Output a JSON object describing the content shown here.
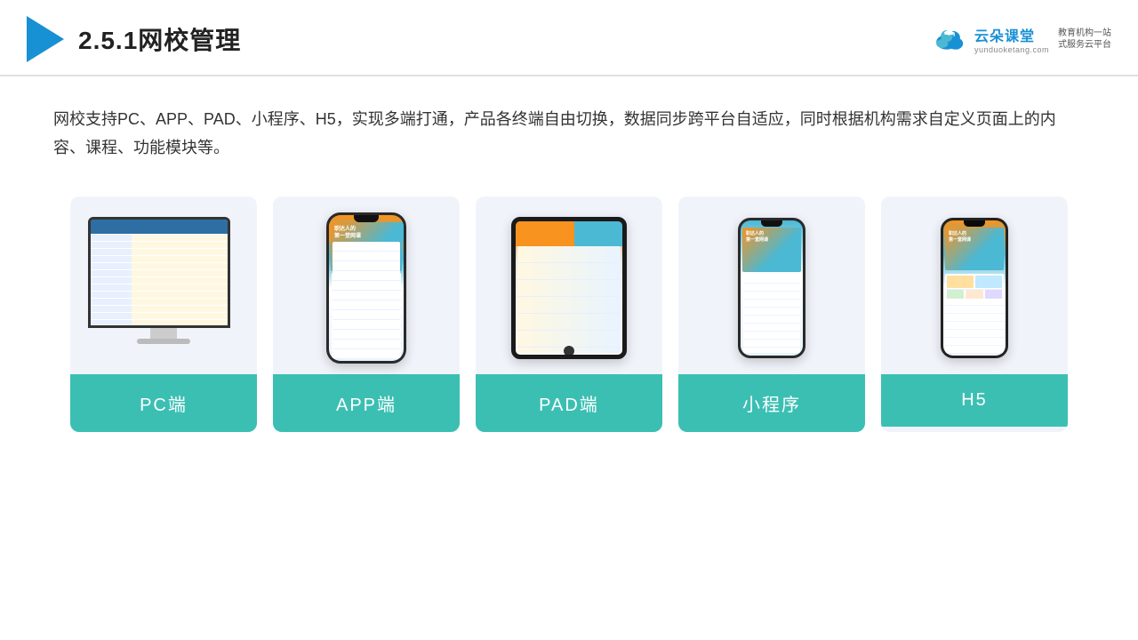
{
  "header": {
    "title": "2.5.1网校管理",
    "brand": {
      "name": "云朵课堂",
      "url": "yunduoketang.com",
      "slogan": "教育机构一站\n式服务云平台"
    }
  },
  "description": "网校支持PC、APP、PAD、小程序、H5，实现多端打通，产品各终端自由切换，数据同步跨平台自适应，同时根据机构需求自定义页面上的内容、课程、功能模块等。",
  "cards": [
    {
      "id": "pc",
      "label": "PC端",
      "device": "pc"
    },
    {
      "id": "app",
      "label": "APP端",
      "device": "phone"
    },
    {
      "id": "pad",
      "label": "PAD端",
      "device": "tablet"
    },
    {
      "id": "mini",
      "label": "小程序",
      "device": "phone2"
    },
    {
      "id": "h5",
      "label": "H5",
      "device": "phone3"
    }
  ]
}
